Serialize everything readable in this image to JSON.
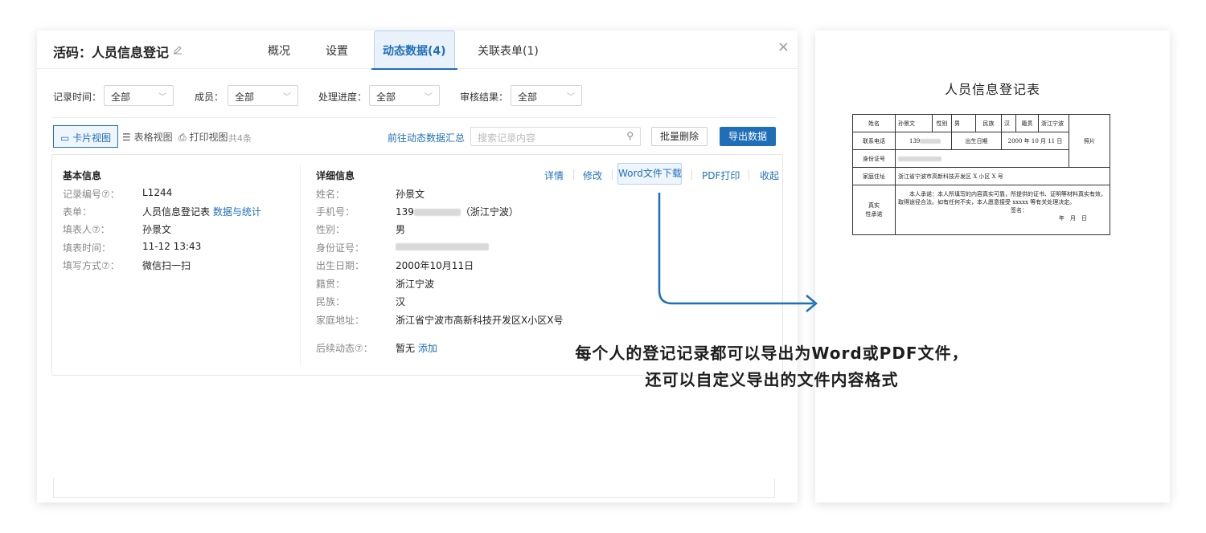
{
  "header": {
    "title": "活码：人员信息登记",
    "tabs": [
      "概况",
      "设置",
      "动态数据(4)",
      "关联表单(1)"
    ],
    "close": "×"
  },
  "filters": [
    {
      "label": "记录时间：",
      "value": "全部"
    },
    {
      "label": "成员：",
      "value": "全部"
    },
    {
      "label": "处理进度：",
      "value": "全部"
    },
    {
      "label": "审核结果：",
      "value": "全部"
    }
  ],
  "toolbar": {
    "card_view": "卡片视图",
    "table_view": "表格视图",
    "print_view": "打印视图",
    "count": "共4条",
    "summary_link": "前往动态数据汇总",
    "search_placeholder": "搜索记录内容",
    "batch_delete": "批量删除",
    "export": "导出数据"
  },
  "basic_info": {
    "title": "基本信息",
    "rows": [
      {
        "label": "记录编号⑦：",
        "value": "L1244"
      },
      {
        "label": "表单：",
        "value": "人员信息登记表",
        "link": "数据与统计"
      },
      {
        "label": "填表人⑦：",
        "value": "孙景文"
      },
      {
        "label": "填表时间：",
        "value": "11-12 13:43"
      },
      {
        "label": "填写方式⑦：",
        "value": "微信扫一扫"
      }
    ]
  },
  "detail_info": {
    "title": "详细信息",
    "actions": [
      "详情",
      "修改",
      "Word文件下载",
      "PDF打印",
      "收起"
    ],
    "rows": [
      {
        "label": "姓名：",
        "value": "孙景文"
      },
      {
        "label": "手机号：",
        "value": "139",
        "suffix": "（浙江宁波）"
      },
      {
        "label": "性别：",
        "value": "男"
      },
      {
        "label": "身份证号：",
        "value": ""
      },
      {
        "label": "出生日期：",
        "value": "2000年10月11日"
      },
      {
        "label": "籍贯：",
        "value": "浙江宁波"
      },
      {
        "label": "民族：",
        "value": "汉"
      },
      {
        "label": "家庭地址：",
        "value": "浙江省宁波市高新科技开发区X小区X号"
      }
    ],
    "followup": {
      "label": "后续动态⑦：",
      "value": "暂无",
      "link": "添加"
    }
  },
  "caption": {
    "line1": "每个人的登记记录都可以导出为Word或PDF文件，",
    "line2": "还可以自定义导出的文件内容格式"
  },
  "document": {
    "title": "人员信息登记表",
    "name_label": "姓名",
    "name": "孙景文",
    "gender_label": "性别",
    "gender": "男",
    "ethnic_label": "民族",
    "ethnic": "汉",
    "origin_label": "籍贯",
    "origin": "浙江宁波",
    "phone_label": "联系电话",
    "phone": "139",
    "birth_label": "出生日期",
    "birth": "2000 年 10 月 11 日",
    "photo": "照片",
    "id_label": "身份证号",
    "address_label": "家庭住址",
    "address": "浙江省宁波市高新科技开发区 X 小区 X 号",
    "pledge_label_1": "真实",
    "pledge_label_2": "性承诺",
    "pledge_1": "本人承诺：本人所填写的内容真实可靠，所提供的证书、证明等材料真实有效，",
    "pledge_2": "取得途径合法。如有任何不实，本人愿意接受 xxxxx 等有关处理决定。",
    "sign": "签名：",
    "date": "年　月　日"
  }
}
